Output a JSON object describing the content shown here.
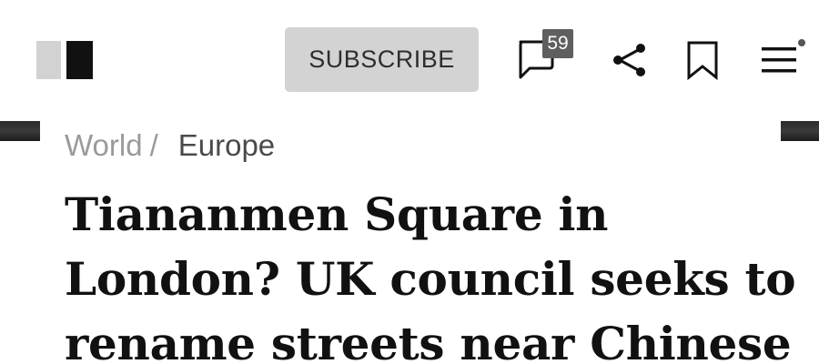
{
  "header": {
    "subscribe_label": "SUBSCRIBE",
    "comment_count": "59",
    "icons": [
      "logo-icon",
      "comments-icon",
      "share-icon",
      "bookmark-icon",
      "menu-icon"
    ]
  },
  "breadcrumb": {
    "section": "World",
    "separator": "/",
    "subsection": "Europe"
  },
  "article": {
    "headline_lines": [
      "Tiananmen Square in",
      "London? UK council seeks to",
      "rename streets near Chinese"
    ]
  },
  "colors": {
    "subscribe_bg": "#d3d3d3",
    "badge_bg": "#5f5f5f",
    "breadcrumb_section": "#9a9a9a",
    "breadcrumb_subsection": "#4a4a4a",
    "headline_text": "#111111"
  }
}
